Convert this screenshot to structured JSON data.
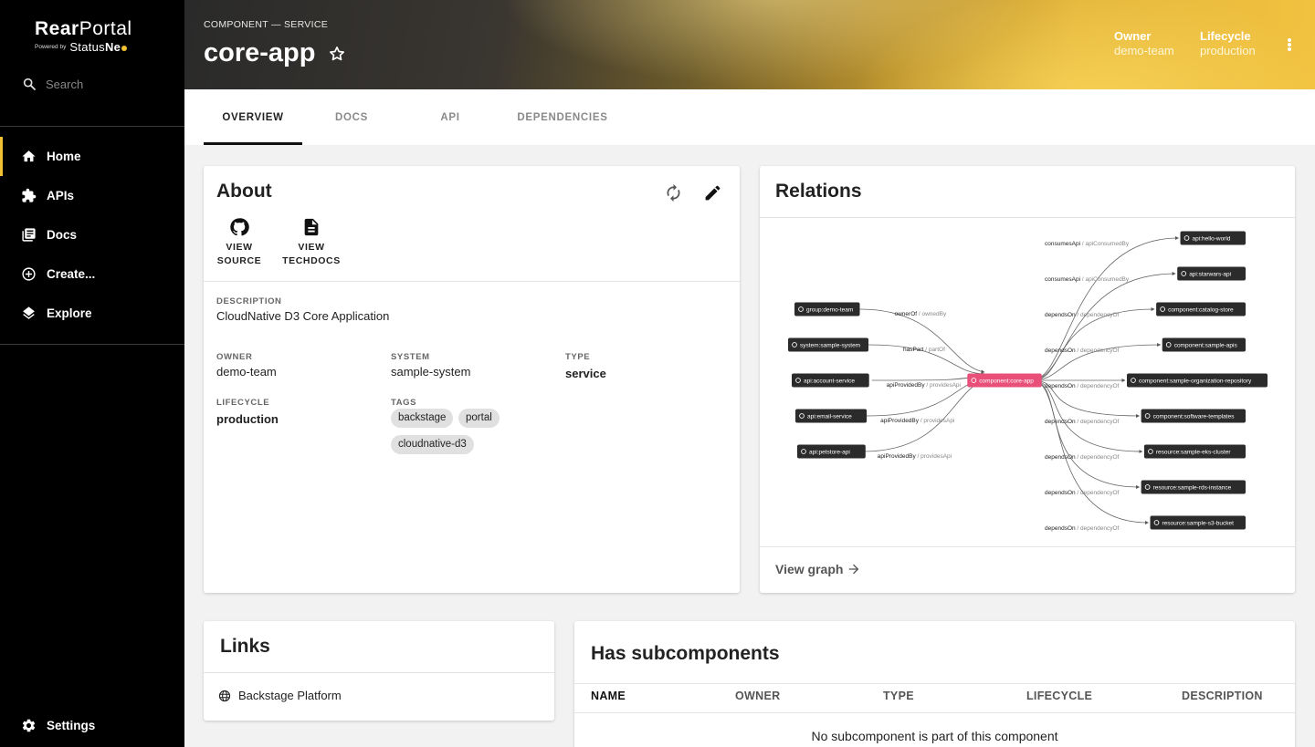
{
  "sidebar": {
    "logo_main_bold": "Rear",
    "logo_main_rest": "Portal",
    "logo_powered": "Powered by",
    "logo_brand_a": "Status",
    "logo_brand_b": "Ne",
    "search_placeholder": "Search",
    "items": [
      {
        "label": "Home",
        "icon": "home-icon",
        "active": true
      },
      {
        "label": "APIs",
        "icon": "puzzle-icon"
      },
      {
        "label": "Docs",
        "icon": "library-icon"
      },
      {
        "label": "Create...",
        "icon": "add-circle-icon"
      },
      {
        "label": "Explore",
        "icon": "layers-icon"
      }
    ],
    "settings_label": "Settings",
    "accent_color": "#f2c232"
  },
  "header": {
    "kind": "COMPONENT — SERVICE",
    "title": "core-app",
    "owner_label": "Owner",
    "owner_value": "demo-team",
    "lifecycle_label": "Lifecycle",
    "lifecycle_value": "production"
  },
  "tabs": [
    {
      "label": "OVERVIEW",
      "active": true
    },
    {
      "label": "DOCS"
    },
    {
      "label": "API"
    },
    {
      "label": "DEPENDENCIES"
    }
  ],
  "about": {
    "title": "About",
    "view_source_1": "VIEW",
    "view_source_2": "SOURCE",
    "view_techdocs_1": "VIEW",
    "view_techdocs_2": "TECHDOCS",
    "description_label": "DESCRIPTION",
    "description": "CloudNative D3 Core Application",
    "owner_label": "OWNER",
    "owner": "demo-team",
    "system_label": "SYSTEM",
    "system": "sample-system",
    "type_label": "TYPE",
    "type": "service",
    "lifecycle_label": "LIFECYCLE",
    "lifecycle": "production",
    "tags_label": "TAGS",
    "tags": [
      "backstage",
      "portal",
      "cloudnative-d3"
    ]
  },
  "relations": {
    "title": "Relations",
    "view_graph": "View graph",
    "center": "component:core-app",
    "center_color": "#e8507a",
    "left_nodes": [
      {
        "label": "group:demo-team",
        "rel": "ownerOf",
        "rev": "ownedBy"
      },
      {
        "label": "system:sample-system",
        "rel": "hasPart",
        "rev": "partOf"
      },
      {
        "label": "api:account-service",
        "rel": "apiProvidedBy",
        "rev": "providesApi"
      },
      {
        "label": "api:email-service",
        "rel": "apiProvidedBy",
        "rev": "providesApi"
      },
      {
        "label": "api:petstore-api",
        "rel": "apiProvidedBy",
        "rev": "providesApi"
      }
    ],
    "right_nodes": [
      {
        "label": "api:hello-world",
        "rel": "consumesApi",
        "rev": "apiConsumedBy"
      },
      {
        "label": "api:starwars-api",
        "rel": "consumesApi",
        "rev": "apiConsumedBy"
      },
      {
        "label": "component:catalog-store",
        "rel": "dependsOn",
        "rev": "dependencyOf"
      },
      {
        "label": "component:sample-apis",
        "rel": "dependsOn",
        "rev": "dependencyOf"
      },
      {
        "label": "component:sample-organization-repository",
        "rel": "dependsOn",
        "rev": "dependencyOf"
      },
      {
        "label": "component:software-templates",
        "rel": "dependsOn",
        "rev": "dependencyOf"
      },
      {
        "label": "resource:sample-eks-cluster",
        "rel": "dependsOn",
        "rev": "dependencyOf"
      },
      {
        "label": "resource:sample-rds-instance",
        "rel": "dependsOn",
        "rev": "dependencyOf"
      },
      {
        "label": "resource:sample-s3-bucket",
        "rel": "dependsOn",
        "rev": "dependencyOf"
      }
    ]
  },
  "links": {
    "title": "Links",
    "items": [
      {
        "label": "Backstage Platform",
        "icon": "globe-icon"
      }
    ]
  },
  "subcomponents": {
    "title": "Has subcomponents",
    "columns": [
      "NAME",
      "OWNER",
      "TYPE",
      "LIFECYCLE",
      "DESCRIPTION"
    ],
    "empty_text": "No subcomponent is part of this component"
  }
}
